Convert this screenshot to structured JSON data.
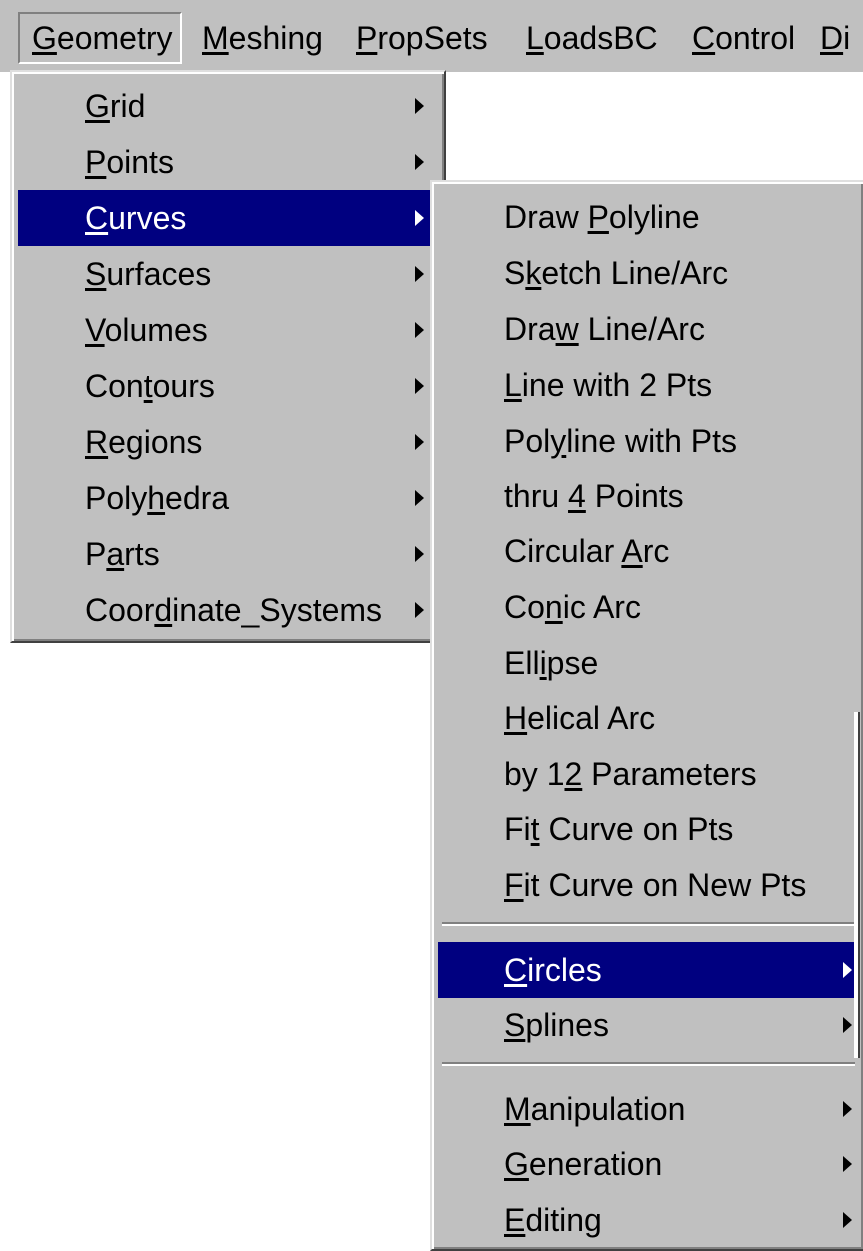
{
  "menubar": {
    "items": [
      {
        "pre": "",
        "key": "G",
        "post": "eometry"
      },
      {
        "pre": "",
        "key": "M",
        "post": "eshing"
      },
      {
        "pre": "",
        "key": "P",
        "post": "ropSets"
      },
      {
        "pre": "",
        "key": "L",
        "post": "oadsBC"
      },
      {
        "pre": "",
        "key": "C",
        "post": "ontrol"
      },
      {
        "pre": "",
        "key": "D",
        "post": "i"
      }
    ]
  },
  "geometry_menu": {
    "items": [
      {
        "pre": "",
        "key": "G",
        "post": "rid"
      },
      {
        "pre": "",
        "key": "P",
        "post": "oints"
      },
      {
        "pre": "",
        "key": "C",
        "post": "urves"
      },
      {
        "pre": "",
        "key": "S",
        "post": "urfaces"
      },
      {
        "pre": "",
        "key": "V",
        "post": "olumes"
      },
      {
        "pre": "Con",
        "key": "t",
        "post": "ours"
      },
      {
        "pre": "",
        "key": "R",
        "post": "egions"
      },
      {
        "pre": "Poly",
        "key": "h",
        "post": "edra"
      },
      {
        "pre": "P",
        "key": "a",
        "post": "rts"
      },
      {
        "pre": "Coor",
        "key": "d",
        "post": "inate_Systems"
      }
    ]
  },
  "curves_menu": {
    "items": [
      {
        "pre": "Draw ",
        "key": "P",
        "post": "olyline"
      },
      {
        "pre": "S",
        "key": "k",
        "post": "etch Line/Arc"
      },
      {
        "pre": "Dra",
        "key": "w",
        "post": " Line/Arc"
      },
      {
        "pre": "",
        "key": "L",
        "post": "ine with 2 Pts"
      },
      {
        "pre": "Pol",
        "key": "y",
        "post": "line with Pts"
      },
      {
        "pre": "thru ",
        "key": "4",
        "post": " Points"
      },
      {
        "pre": "Circular ",
        "key": "A",
        "post": "rc"
      },
      {
        "pre": "Co",
        "key": "n",
        "post": "ic Arc"
      },
      {
        "pre": "Ell",
        "key": "i",
        "post": "pse"
      },
      {
        "pre": "",
        "key": "H",
        "post": "elical Arc"
      },
      {
        "pre": "by 1",
        "key": "2",
        "post": " Parameters"
      },
      {
        "pre": "Fi",
        "key": "t",
        "post": " Curve on Pts"
      },
      {
        "pre": "",
        "key": "F",
        "post": "it Curve on New Pts"
      },
      {
        "pre": "",
        "key": "C",
        "post": "ircles"
      },
      {
        "pre": "",
        "key": "S",
        "post": "plines"
      },
      {
        "pre": "",
        "key": "M",
        "post": "anipulation"
      },
      {
        "pre": "",
        "key": "G",
        "post": "eneration"
      },
      {
        "pre": "",
        "key": "E",
        "post": "diting"
      }
    ]
  }
}
